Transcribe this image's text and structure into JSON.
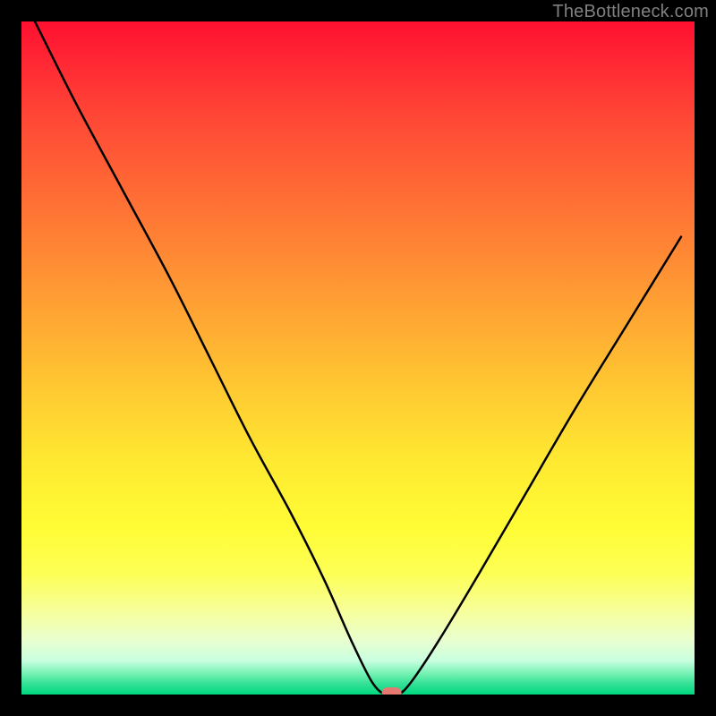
{
  "watermark": "TheBottleneck.com",
  "chart_data": {
    "type": "line",
    "title": "",
    "xlabel": "",
    "ylabel": "",
    "xlim": [
      0,
      100
    ],
    "ylim": [
      0,
      100
    ],
    "grid": false,
    "legend": false,
    "background": "red-to-green vertical gradient",
    "series": [
      {
        "name": "bottleneck-curve",
        "x": [
          2,
          8,
          15,
          22,
          28,
          34,
          40,
          45,
          49,
          52,
          54,
          56,
          58,
          62,
          68,
          75,
          82,
          90,
          98
        ],
        "y": [
          100,
          88,
          75,
          62,
          50,
          38,
          27,
          17,
          8,
          2,
          0,
          0,
          2,
          8,
          18,
          30,
          42,
          55,
          68
        ]
      }
    ],
    "marker": {
      "x": 55,
      "y": 0,
      "shape": "rounded-rect",
      "color": "#e57870"
    },
    "colors": {
      "top": "#ff1030",
      "bottom": "#00d97f",
      "curve": "#000000",
      "marker": "#e57870",
      "frame": "#000000"
    }
  }
}
